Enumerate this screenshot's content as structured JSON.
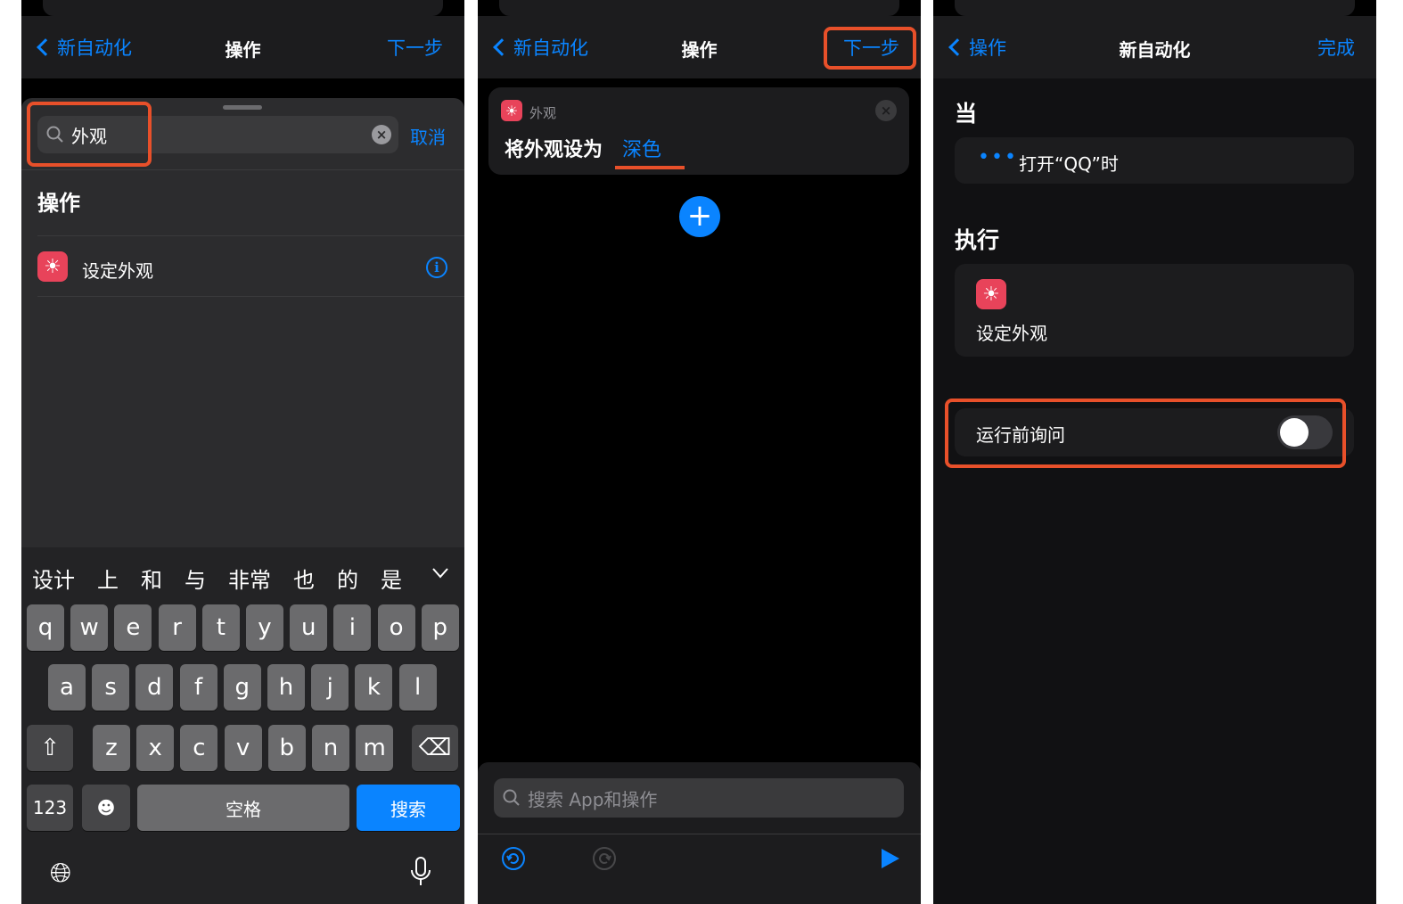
{
  "panel1": {
    "nav": {
      "back": "新自动化",
      "title": "操作",
      "next": "下一步"
    },
    "search": {
      "value": "外观",
      "cancel": "取消"
    },
    "section": "操作",
    "action": {
      "label": "设定外观"
    },
    "keyboard": {
      "candidates": [
        "设计",
        "上",
        "和",
        "与",
        "非常",
        "也",
        "的",
        "是"
      ],
      "row1": [
        "q",
        "w",
        "e",
        "r",
        "t",
        "y",
        "u",
        "i",
        "o",
        "p"
      ],
      "row2": [
        "a",
        "s",
        "d",
        "f",
        "g",
        "h",
        "j",
        "k",
        "l"
      ],
      "row3": [
        "z",
        "x",
        "c",
        "v",
        "b",
        "n",
        "m"
      ],
      "num": "123",
      "space": "空格",
      "search": "搜索"
    }
  },
  "panel2": {
    "nav": {
      "back": "新自动化",
      "title": "操作",
      "next": "下一步"
    },
    "card": {
      "category": "外观",
      "text": "将外观设为",
      "value": "深色"
    },
    "search_placeholder": "搜索 App和操作"
  },
  "panel3": {
    "nav": {
      "back": "操作",
      "title": "新自动化",
      "done": "完成"
    },
    "when_header": "当",
    "trigger": "打开“QQ”时",
    "do_header": "执行",
    "action": "设定外观",
    "ask_label": "运行前询问",
    "ask_enabled": false
  },
  "colors": {
    "accent": "#0a84ff",
    "highlight": "#e8502a",
    "action_icon": "#e8435a"
  }
}
